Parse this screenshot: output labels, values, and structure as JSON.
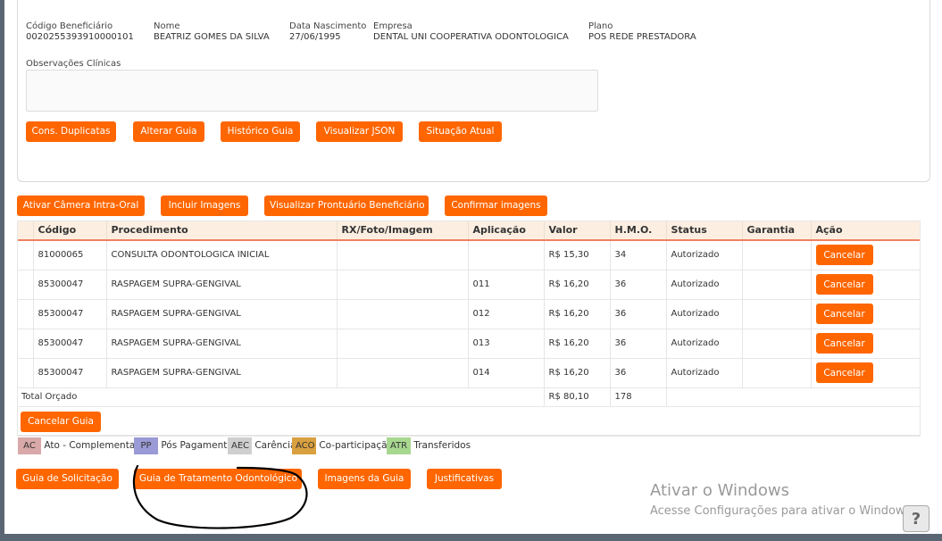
{
  "beneficiary": {
    "codigo_label": "Código Beneficiário",
    "codigo_value": "0020255393910000101",
    "nome_label": "Nome",
    "nome_value": "BEATRIZ GOMES DA SILVA",
    "nascimento_label": "Data Nascimento",
    "nascimento_value": "27/06/1995",
    "empresa_label": "Empresa",
    "empresa_value": "DENTAL UNI COOPERATIVA ODONTOLOGICA",
    "plano_label": "Plano",
    "plano_value": "POS REDE PRESTADORA"
  },
  "observacoes": {
    "label": "Observações Clínicas",
    "value": ""
  },
  "top_buttons": [
    "Cons. Duplicatas",
    "Alterar Guia",
    "Histórico Guia",
    "Visualizar JSON",
    "Situação Atual"
  ],
  "mid_buttons": [
    "Ativar Câmera Intra-Oral",
    "Incluir Imagens",
    "Visualizar Prontuário Beneficiário",
    "Confirmar imagens"
  ],
  "table": {
    "headers": [
      "",
      "Código",
      "Procedimento",
      "RX/Foto/Imagem",
      "Aplicação",
      "Valor",
      "H.M.O.",
      "Status",
      "Garantia",
      "Ação"
    ],
    "rows": [
      {
        "codigo": "81000065",
        "procedimento": "CONSULTA ODONTOLOGICA INICIAL",
        "rx": "",
        "aplicacao": "",
        "valor": "R$ 15,30",
        "hmo": "34",
        "status": "Autorizado",
        "garantia": "",
        "acao": "Cancelar"
      },
      {
        "codigo": "85300047",
        "procedimento": "RASPAGEM SUPRA-GENGIVAL",
        "rx": "",
        "aplicacao": "011",
        "valor": "R$ 16,20",
        "hmo": "36",
        "status": "Autorizado",
        "garantia": "",
        "acao": "Cancelar"
      },
      {
        "codigo": "85300047",
        "procedimento": "RASPAGEM SUPRA-GENGIVAL",
        "rx": "",
        "aplicacao": "012",
        "valor": "R$ 16,20",
        "hmo": "36",
        "status": "Autorizado",
        "garantia": "",
        "acao": "Cancelar"
      },
      {
        "codigo": "85300047",
        "procedimento": "RASPAGEM SUPRA-GENGIVAL",
        "rx": "",
        "aplicacao": "013",
        "valor": "R$ 16,20",
        "hmo": "36",
        "status": "Autorizado",
        "garantia": "",
        "acao": "Cancelar"
      },
      {
        "codigo": "85300047",
        "procedimento": "RASPAGEM SUPRA-GENGIVAL",
        "rx": "",
        "aplicacao": "014",
        "valor": "R$ 16,20",
        "hmo": "36",
        "status": "Autorizado",
        "garantia": "",
        "acao": "Cancelar"
      }
    ],
    "total_label": "Total Orçado",
    "total_valor": "R$ 80,10",
    "total_hmo": "178",
    "cancel_guide": "Cancelar Guia"
  },
  "legend": [
    {
      "code": "AC",
      "text": "Ato - Complementar",
      "color": "#d9a8a8"
    },
    {
      "code": "PP",
      "text": "Pós Pagamento",
      "color": "#9a9ad6"
    },
    {
      "code": "AEC",
      "text": "Carência",
      "color": "#cfcfcf"
    },
    {
      "code": "ACO",
      "text": "Co-participação",
      "color": "#d9a040"
    },
    {
      "code": "ATR",
      "text": "Transferidos",
      "color": "#a8d890"
    }
  ],
  "bottom_buttons": [
    "Guia de Solicitação",
    "Guia de Tratamento Odontológico",
    "Imagens da Guia",
    "Justificativas"
  ],
  "watermark": {
    "title": "Ativar o Windows",
    "subtitle": "Acesse Configurações para ativar o Windows."
  },
  "colors": {
    "accent": "#ff6600",
    "header_bg": "#fcefe2"
  },
  "icons": {
    "help": "help-icon"
  }
}
